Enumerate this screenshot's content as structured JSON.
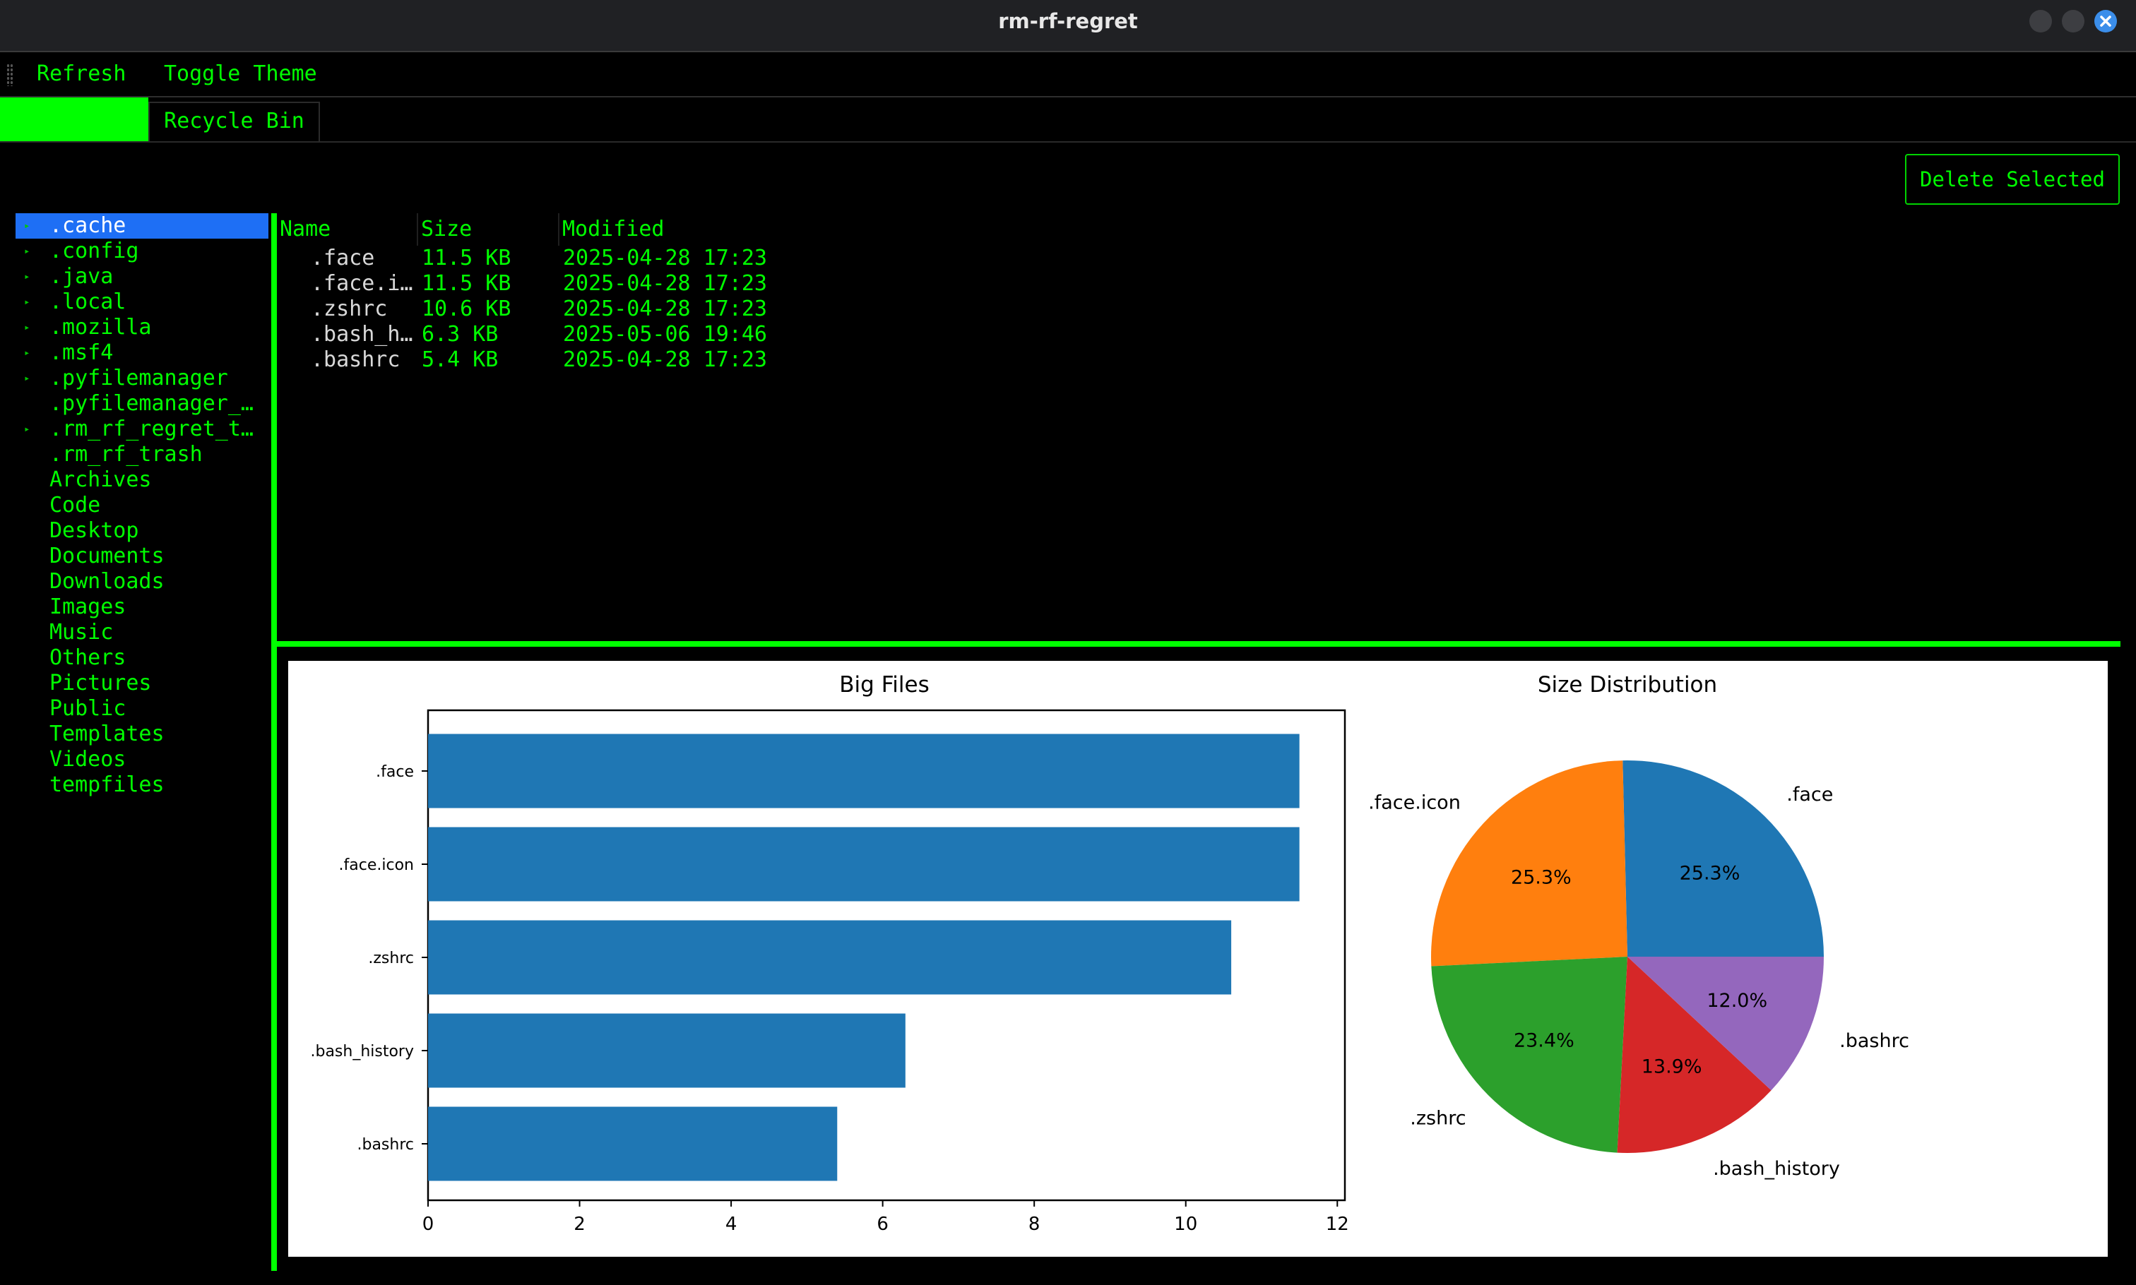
{
  "window": {
    "title": "rm-rf-regret"
  },
  "menu": {
    "refresh": "Refresh",
    "toggle_theme": "Toggle Theme"
  },
  "tabs": [
    {
      "label": ""
    },
    {
      "label": "Recycle Bin"
    }
  ],
  "toolbar": {
    "delete_selected": "Delete Selected"
  },
  "tree": {
    "items": [
      {
        "label": ".cache",
        "expandable": true,
        "selected": true
      },
      {
        "label": ".config",
        "expandable": true
      },
      {
        "label": ".java",
        "expandable": true
      },
      {
        "label": ".local",
        "expandable": true
      },
      {
        "label": ".mozilla",
        "expandable": true
      },
      {
        "label": ".msf4",
        "expandable": true
      },
      {
        "label": ".pyfilemanager",
        "expandable": true
      },
      {
        "label": ".pyfilemanager_…",
        "expandable": false
      },
      {
        "label": ".rm_rf_regret_t…",
        "expandable": true
      },
      {
        "label": ".rm_rf_trash",
        "expandable": false
      },
      {
        "label": "Archives",
        "expandable": false
      },
      {
        "label": "Code",
        "expandable": false
      },
      {
        "label": "Desktop",
        "expandable": false
      },
      {
        "label": "Documents",
        "expandable": false
      },
      {
        "label": "Downloads",
        "expandable": false
      },
      {
        "label": "Images",
        "expandable": false
      },
      {
        "label": "Music",
        "expandable": false
      },
      {
        "label": "Others",
        "expandable": false
      },
      {
        "label": "Pictures",
        "expandable": false
      },
      {
        "label": "Public",
        "expandable": false
      },
      {
        "label": "Templates",
        "expandable": false
      },
      {
        "label": "Videos",
        "expandable": false
      },
      {
        "label": "tempfiles",
        "expandable": false
      }
    ]
  },
  "file_table": {
    "columns": [
      "Name",
      "Size",
      "Modified"
    ],
    "rows": [
      {
        "name": ".face",
        "size": "11.5 KB",
        "modified": "2025-04-28 17:23"
      },
      {
        "name": ".face.i…",
        "size": "11.5 KB",
        "modified": "2025-04-28 17:23"
      },
      {
        "name": ".zshrc",
        "size": "10.6 KB",
        "modified": "2025-04-28 17:23"
      },
      {
        "name": ".bash_h…",
        "size": "6.3 KB",
        "modified": "2025-05-06 19:46"
      },
      {
        "name": ".bashrc",
        "size": "5.4 KB",
        "modified": "2025-04-28 17:23"
      }
    ]
  },
  "colors": {
    "accent": "#00ff00",
    "selection": "#1e6ff5",
    "bar": "#1f77b4",
    "pie": [
      "#1f77b4",
      "#ff7f0e",
      "#2ca02c",
      "#d62728",
      "#9467bd"
    ]
  },
  "chart_data": [
    {
      "type": "bar",
      "orientation": "horizontal",
      "title": "Big Files",
      "categories": [
        ".face",
        ".face.icon",
        ".zshrc",
        ".bash_history",
        ".bashrc"
      ],
      "values": [
        11.5,
        11.5,
        10.6,
        6.3,
        5.4
      ],
      "xlim": [
        0,
        12.1
      ],
      "xticks": [
        0,
        2,
        4,
        6,
        8,
        10,
        12
      ],
      "xlabel": "",
      "ylabel": ""
    },
    {
      "type": "pie",
      "title": "Size Distribution",
      "labels": [
        ".face",
        ".face.icon",
        ".zshrc",
        ".bash_history",
        ".bashrc"
      ],
      "percentages": [
        "25.3%",
        "25.3%",
        "23.4%",
        "13.9%",
        "12.0%"
      ],
      "values": [
        11.5,
        11.5,
        10.6,
        6.3,
        5.4
      ]
    }
  ]
}
